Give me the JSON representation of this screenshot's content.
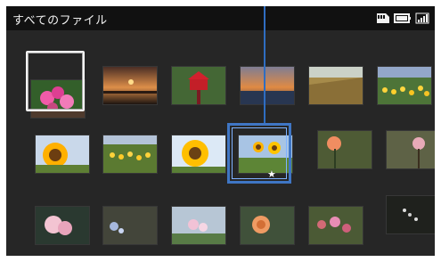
{
  "header": {
    "title": "すべてのファイル"
  },
  "status_icons": [
    "memory-card-icon",
    "battery-icon",
    "signal-icon"
  ],
  "grid": {
    "rows": 3,
    "cols": 6,
    "highlighted_index": 0,
    "selected_index": 9,
    "selected_has_favorite_star": true,
    "favorite_star": "★"
  },
  "colors": {
    "background": "#262626",
    "header": "#111111",
    "selection_blue": "#3f76c4",
    "cursor_white": "#f4f4f4"
  }
}
